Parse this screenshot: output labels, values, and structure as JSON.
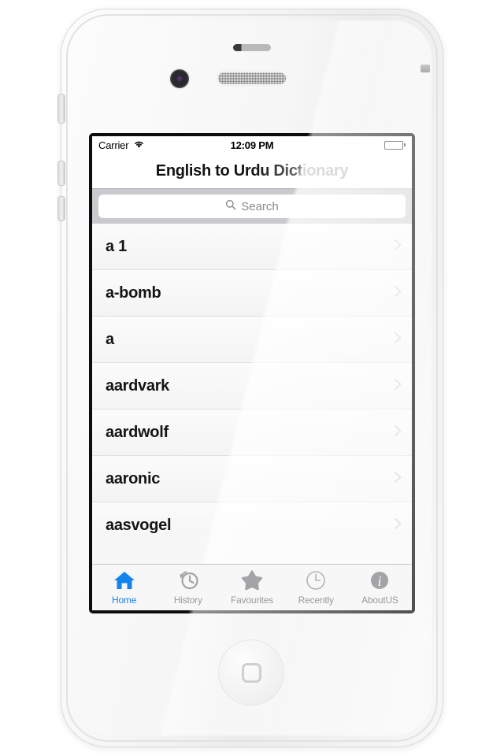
{
  "device": {
    "name": "white-smartphone",
    "hardware": {
      "front_camera": "camera-icon",
      "earpiece": "speaker-grille",
      "sensor": "proximity-sensor",
      "home_button": "home-button",
      "mute_switch": "mute-switch",
      "volume_up": "volume-up-button",
      "volume_down": "volume-down-button",
      "power": "power-button"
    }
  },
  "status_bar": {
    "carrier": "Carrier",
    "wifi_icon": "wifi-icon",
    "time": "12:09 PM",
    "battery_icon": "battery-icon"
  },
  "nav_bar": {
    "title": "English to Urdu Dictionary"
  },
  "search": {
    "icon": "search-icon",
    "placeholder": "Search",
    "value": ""
  },
  "list": {
    "items": [
      {
        "label": "a 1",
        "accessory": "chevron-right-icon"
      },
      {
        "label": "a-bomb",
        "accessory": "chevron-right-icon"
      },
      {
        "label": "a",
        "accessory": "chevron-right-icon"
      },
      {
        "label": "aardvark",
        "accessory": "chevron-right-icon"
      },
      {
        "label": "aardwolf",
        "accessory": "chevron-right-icon"
      },
      {
        "label": "aaronic",
        "accessory": "chevron-right-icon"
      },
      {
        "label": "aasvogel",
        "accessory": "chevron-right-icon"
      }
    ]
  },
  "tab_bar": {
    "active_index": 0,
    "active_color": "#1383ee",
    "inactive_color": "#9a9a9f",
    "items": [
      {
        "label": "Home",
        "icon": "home-icon"
      },
      {
        "label": "History",
        "icon": "history-clock-icon"
      },
      {
        "label": "Favourites",
        "icon": "star-icon"
      },
      {
        "label": "Recently",
        "icon": "clock-icon"
      },
      {
        "label": "AboutUS",
        "icon": "info-icon"
      }
    ]
  }
}
